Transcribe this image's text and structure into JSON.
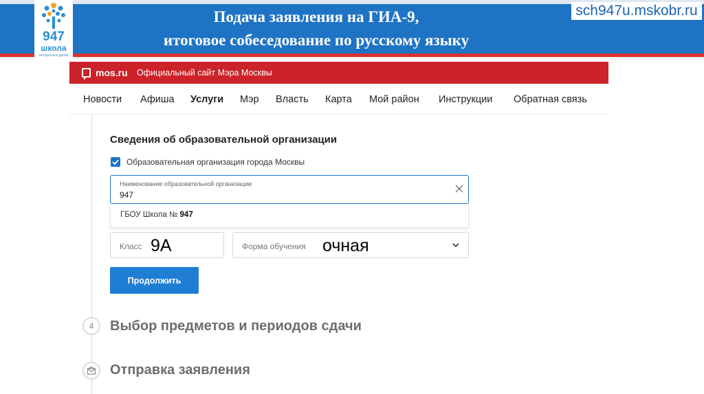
{
  "slide": {
    "title_line1": "Подача заявления на ГИА-9,",
    "title_line2": "итоговое собеседование по русскому языку",
    "site": "sch947u.mskobr.ru",
    "logo_number": "947",
    "logo_word": "школа",
    "logo_tagline": "интересных детей"
  },
  "mos_bar": {
    "brand": "mos.ru",
    "tagline": "Официальный сайт Мэра Москвы"
  },
  "nav": {
    "items": [
      {
        "label": "Новости"
      },
      {
        "label": "Афиша"
      },
      {
        "label": "Услуги"
      },
      {
        "label": "Мэр"
      },
      {
        "label": "Власть"
      },
      {
        "label": "Карта"
      },
      {
        "label": "Мой район"
      },
      {
        "label": "Инструкции"
      },
      {
        "label": "Обратная связь"
      }
    ]
  },
  "form": {
    "section_title": "Сведения об образовательной организации",
    "checkbox_label": "Образовательная организация города Москвы",
    "checkbox_checked": true,
    "org_field_label": "Наименование образовательной организации",
    "org_field_value": "947",
    "suggestion_prefix": "ГБОУ Школа №",
    "suggestion_match": "947",
    "class_label": "Класс",
    "class_value": "9А",
    "study_form_label": "Форма обучения",
    "study_form_value": "очная",
    "continue_label": "Продолжить"
  },
  "steps": [
    {
      "number": "4",
      "title": "Выбор предметов и периодов сдачи"
    },
    {
      "icon": "envelope-icon",
      "title": "Отправка заявления"
    }
  ],
  "colors": {
    "header_blue": "#1f73c4",
    "mos_red": "#cc2229",
    "accent_blue": "#1f7dd4"
  }
}
